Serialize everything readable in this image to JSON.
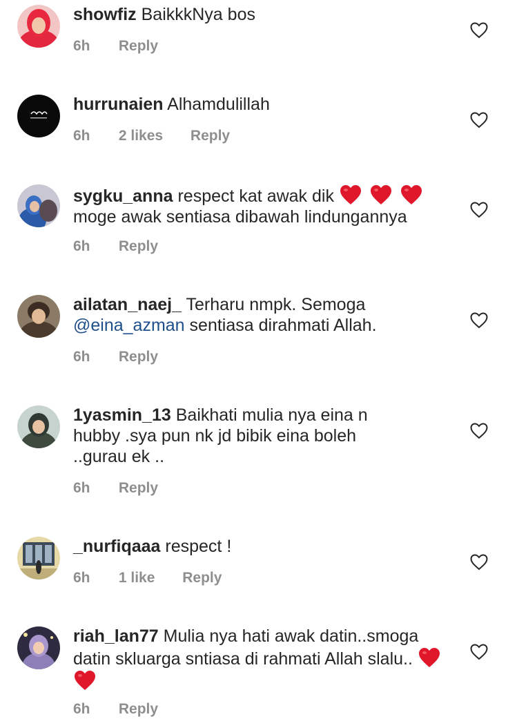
{
  "comments": [
    {
      "username": "showfiz",
      "text": "BaikkkNya bos",
      "time": "6h",
      "likes": "",
      "reply_label": "Reply",
      "avatar_icon": "avatar-red-hijab"
    },
    {
      "username": "hurrunaien",
      "text": "Alhamdulillah",
      "time": "6h",
      "likes": "2 likes",
      "reply_label": "Reply",
      "avatar_icon": "avatar-black-calligraphy"
    },
    {
      "username": "sygku_anna",
      "text": "respect kat awak dik",
      "text2": "moge awak sentiasa dibawah lindungannya",
      "time": "6h",
      "likes": "",
      "reply_label": "Reply",
      "avatar_icon": "avatar-blue-hijab"
    },
    {
      "username": "ailatan_naej_",
      "text": "Terharu nmpk. Semoga",
      "mention": "@eina_azman",
      "text2": "sentiasa dirahmati Allah.",
      "time": "6h",
      "likes": "",
      "reply_label": "Reply",
      "avatar_icon": "avatar-portrait"
    },
    {
      "username": "1yasmin_13",
      "text": "Baikhati mulia nya eina n hubby .sya pun nk jd bibik eina boleh ..gurau ek ..",
      "time": "6h",
      "likes": "",
      "reply_label": "Reply",
      "avatar_icon": "avatar-hijab-outdoor"
    },
    {
      "username": "_nurfiqaaa",
      "text": "respect !",
      "time": "6h",
      "likes": "1 like",
      "reply_label": "Reply",
      "avatar_icon": "avatar-building"
    },
    {
      "username": "riah_lan77",
      "text": "Mulia nya hati awak datin..smoga datin skluarga sntiasa di rahmati Allah slalu..",
      "time": "6h",
      "likes": "",
      "reply_label": "Reply",
      "avatar_icon": "avatar-purple-hijab"
    }
  ],
  "colors": {
    "text": "#262626",
    "meta": "#8e8e8e",
    "mention": "#1f4e8c",
    "heart_emoji": "#e0162b"
  }
}
